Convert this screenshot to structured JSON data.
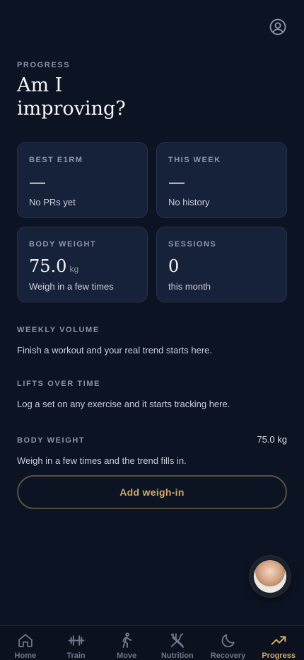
{
  "header": {
    "eyebrow": "PROGRESS",
    "title": "Am I improving?"
  },
  "stats": [
    {
      "label": "BEST E1RM",
      "value": "—",
      "unit": "",
      "sub": "No PRs yet"
    },
    {
      "label": "THIS WEEK",
      "value": "—",
      "unit": "",
      "sub": "No history"
    },
    {
      "label": "BODY WEIGHT",
      "value": "75.0",
      "unit": "kg",
      "sub": "Weigh in a few times"
    },
    {
      "label": "SESSIONS",
      "value": "0",
      "unit": "",
      "sub": "this month"
    }
  ],
  "sections": {
    "weekly_volume": {
      "label": "WEEKLY VOLUME",
      "text": "Finish a workout and your real trend starts here."
    },
    "lifts_over_time": {
      "label": "LIFTS OVER TIME",
      "text": "Log a set on any exercise and it starts tracking here."
    },
    "body_weight": {
      "label": "BODY WEIGHT",
      "value": "75.0 kg",
      "text": "Weigh in a few times and the trend fills in."
    }
  },
  "actions": {
    "add_weighin": "Add weigh-in"
  },
  "tabs": [
    {
      "label": "Home",
      "icon": "home-icon"
    },
    {
      "label": "Train",
      "icon": "dumbbell-icon"
    },
    {
      "label": "Move",
      "icon": "walking-icon"
    },
    {
      "label": "Nutrition",
      "icon": "utensils-icon"
    },
    {
      "label": "Recovery",
      "icon": "moon-icon"
    },
    {
      "label": "Progress",
      "icon": "trend-icon"
    }
  ],
  "colors": {
    "background": "#0c1322",
    "card": "#16223a",
    "accent": "#d2a965"
  }
}
